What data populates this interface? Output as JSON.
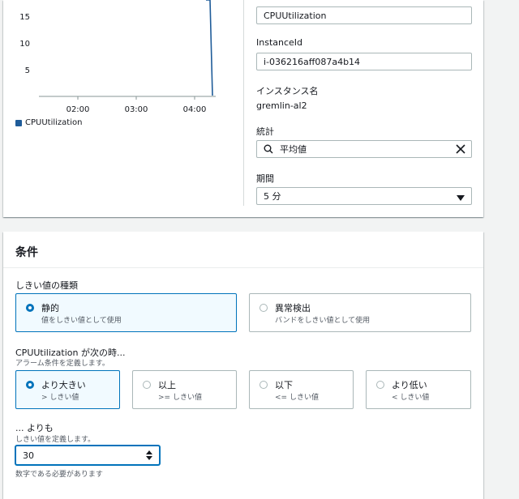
{
  "chart": {
    "y_ticks": [
      "15",
      "10",
      "5"
    ],
    "x_ticks": [
      "02:00",
      "03:00",
      "04:00"
    ],
    "legend": "CPUUtilization",
    "series_color": "#1f5c99"
  },
  "details": {
    "metric_value": "CPUUtilization",
    "instance_id_label": "InstanceId",
    "instance_id_value": "i-036216aff087a4b14",
    "instance_name_label": "インスタンス名",
    "instance_name_value": "gremlin-al2",
    "statistic_label": "統計",
    "statistic_value": "平均値",
    "period_label": "期間",
    "period_value": "5 分"
  },
  "conditions": {
    "title": "条件",
    "threshold_type_label": "しきい値の種類",
    "threshold_types": [
      {
        "title": "静的",
        "desc": "値をしきい値として使用",
        "selected": true
      },
      {
        "title": "異常検出",
        "desc": "バンドをしきい値として使用",
        "selected": false
      }
    ],
    "when_label": "CPUUtilization が次の時...",
    "when_desc": "アラーム条件を定義します。",
    "operators": [
      {
        "title": "より大きい",
        "desc": "> しきい値",
        "selected": true
      },
      {
        "title": "以上",
        "desc": ">= しきい値",
        "selected": false
      },
      {
        "title": "以下",
        "desc": "<= しきい値",
        "selected": false
      },
      {
        "title": "より低い",
        "desc": "< しきい値",
        "selected": false
      }
    ],
    "than_label": "... よりも",
    "than_desc": "しきい値を定義します。",
    "threshold_value": "30",
    "threshold_hint": "数字である必要があります"
  },
  "colors": {
    "accent": "#0073bb",
    "border": "#aab7b8"
  }
}
